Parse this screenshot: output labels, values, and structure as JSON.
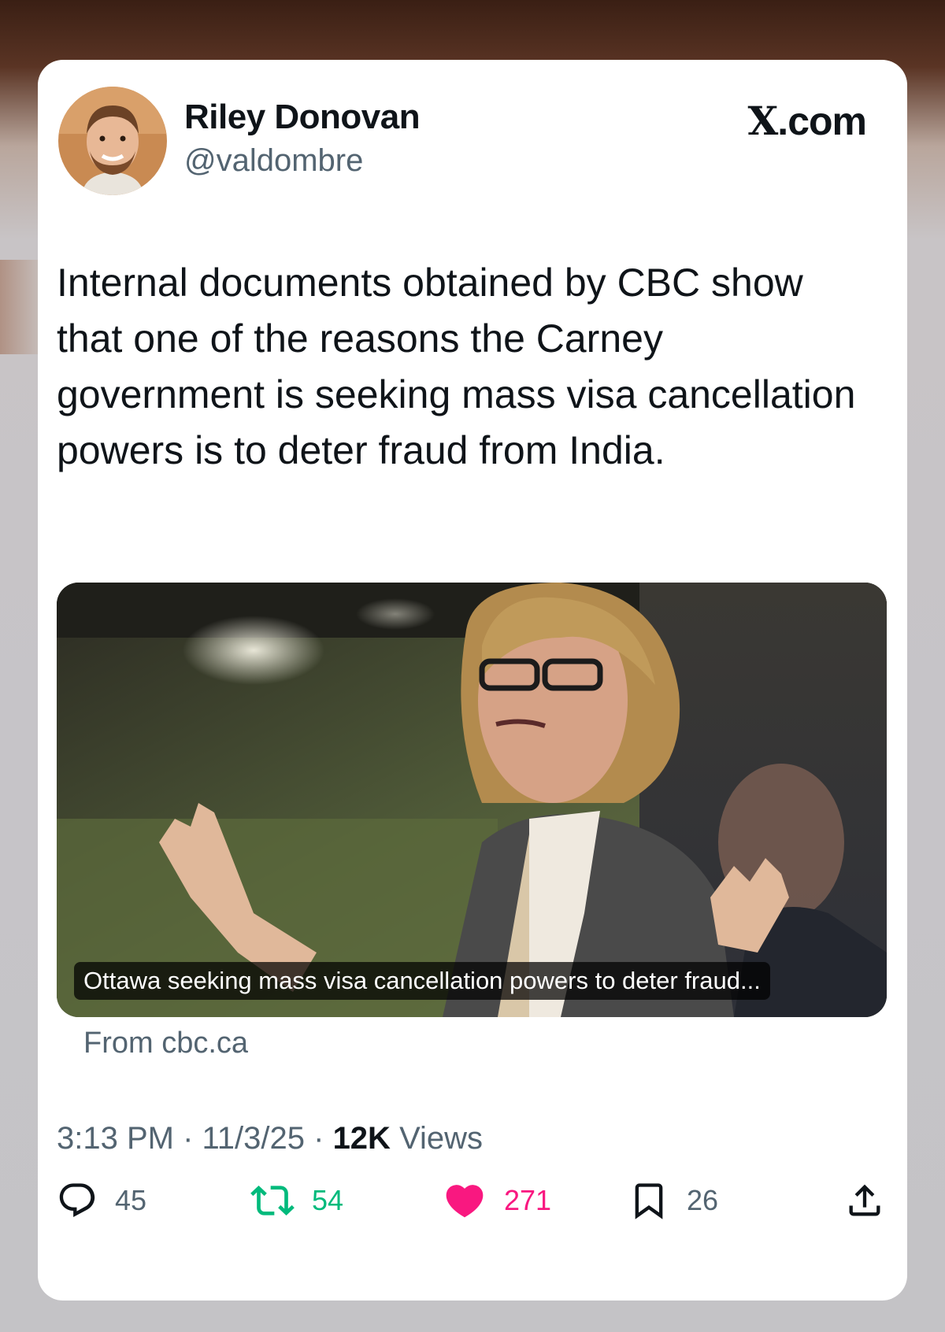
{
  "author": {
    "display_name": "Riley Donovan",
    "handle": "@valdombre"
  },
  "brand": {
    "x_glyph": "X",
    "suffix": ".com"
  },
  "tweet": {
    "text": "Internal documents obtained by CBC show that one of the reasons the Carney government is seeking mass visa cancellation powers is to deter fraud from India."
  },
  "link_card": {
    "caption": "Ottawa seeking mass visa cancellation powers to deter fraud...",
    "source": "From cbc.ca"
  },
  "meta": {
    "time": "3:13 PM",
    "separator": " · ",
    "date": "11/3/25",
    "views_count": "12K",
    "views_label": " Views"
  },
  "actions": {
    "reply": {
      "icon": "reply-icon",
      "count": "45"
    },
    "retweet": {
      "icon": "retweet-icon",
      "count": "54"
    },
    "like": {
      "icon": "heart-icon",
      "count": "271"
    },
    "bookmark": {
      "icon": "bookmark-icon",
      "count": "26"
    },
    "share": {
      "icon": "share-icon"
    }
  },
  "colors": {
    "text_primary": "#0f1419",
    "text_secondary": "#536471",
    "retweet_green": "#00ba7c",
    "like_pink": "#f91880"
  }
}
